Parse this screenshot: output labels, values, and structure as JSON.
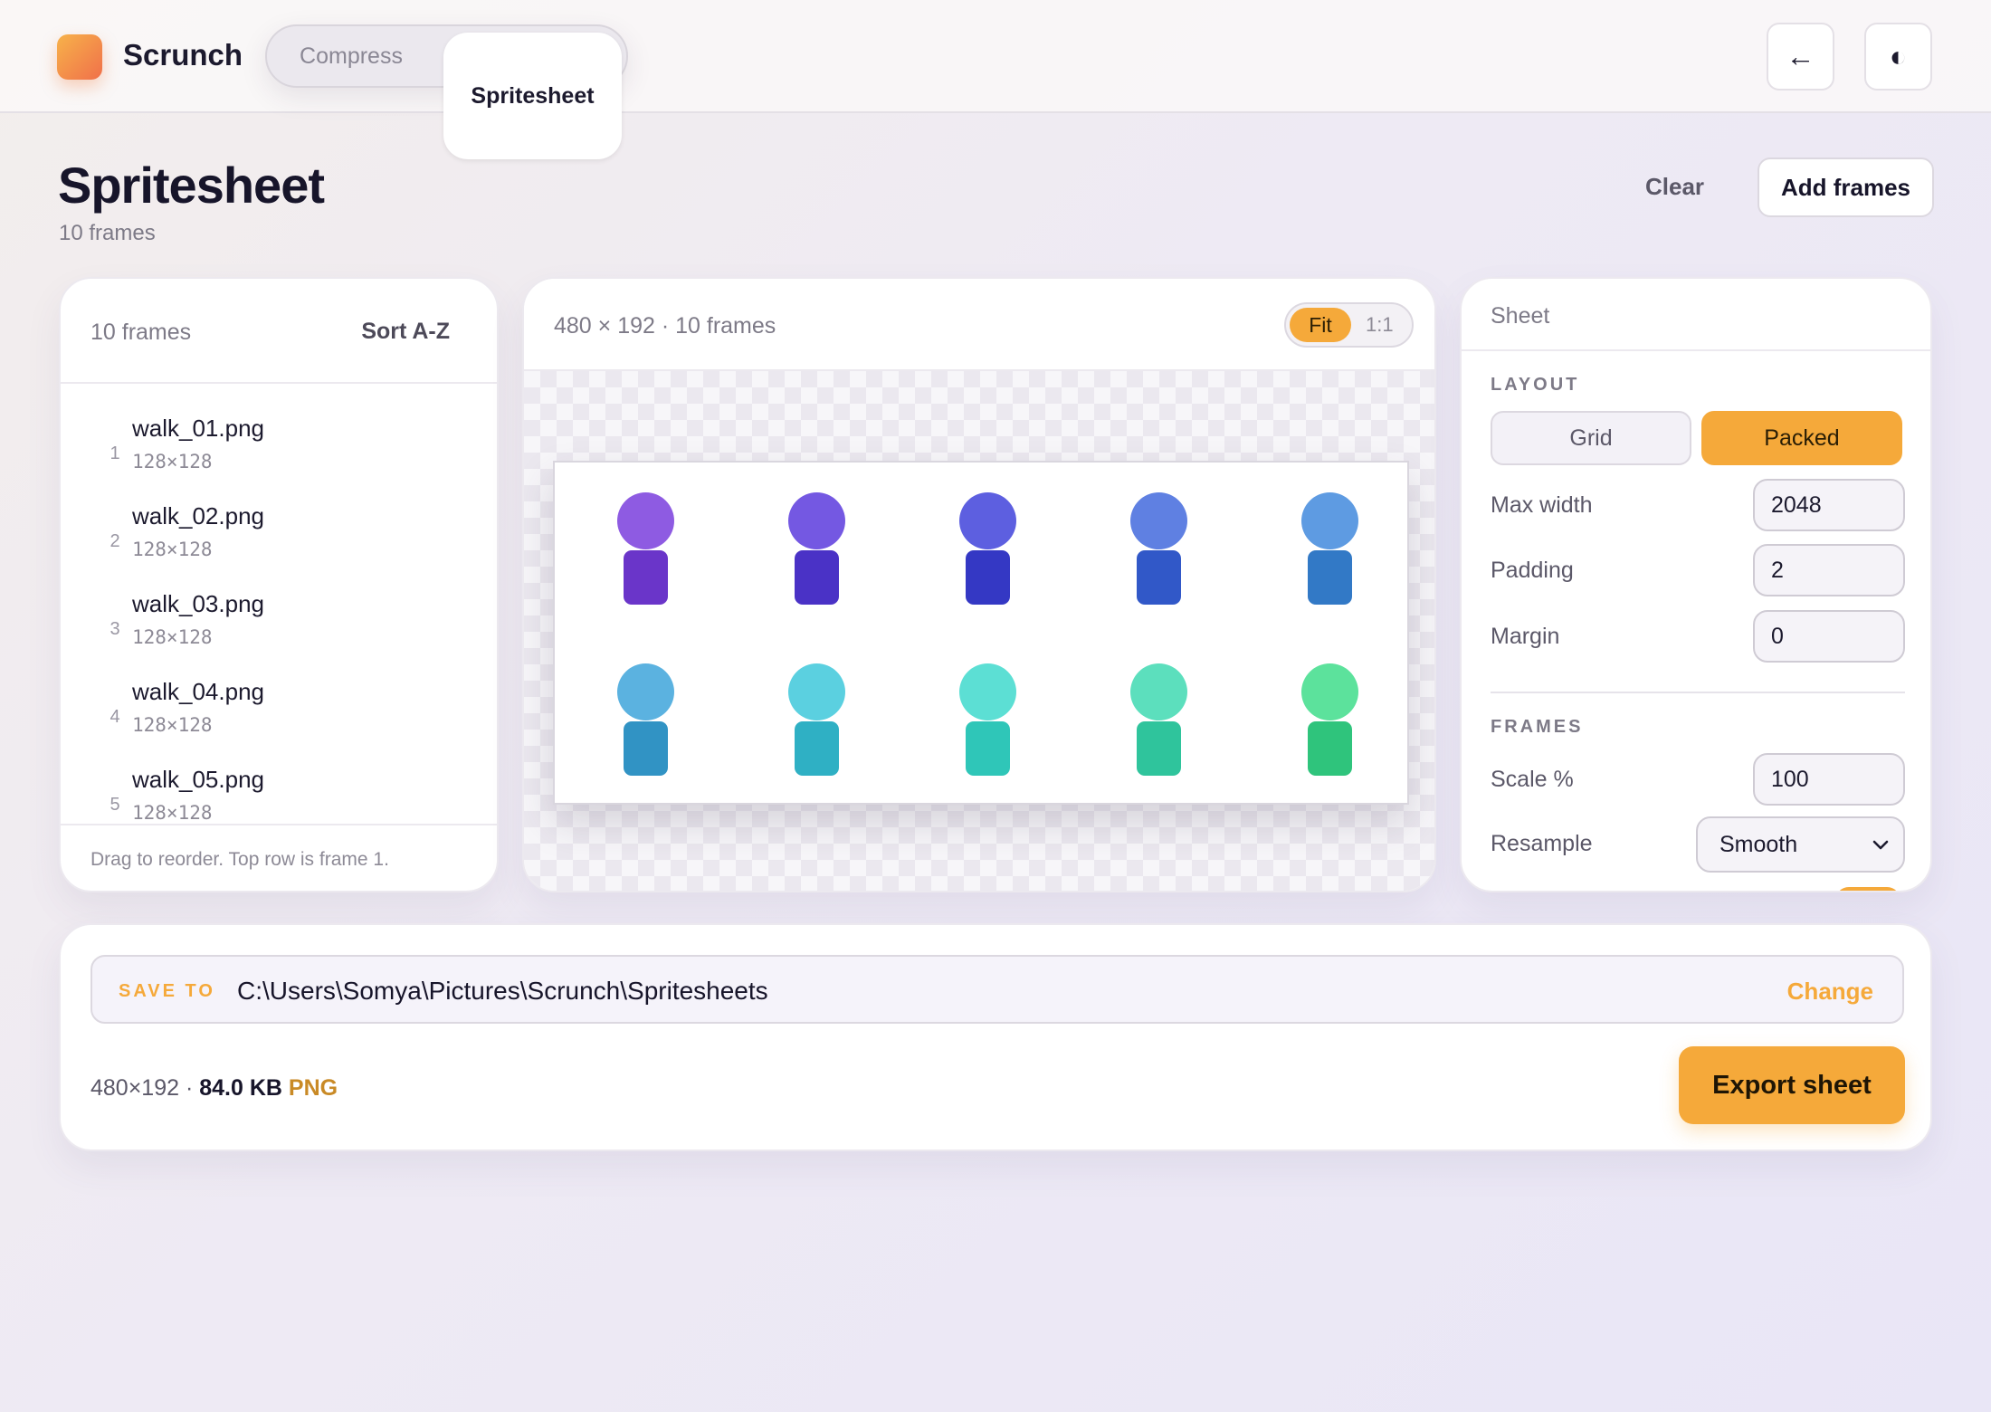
{
  "app": {
    "name": "Scrunch"
  },
  "modes": {
    "compress": "Compress",
    "spritesheet": "Spritesheet"
  },
  "header": {
    "back_icon": "←",
    "theme_icon": "◐"
  },
  "page": {
    "title": "Spritesheet",
    "subtitle": "10 frames",
    "clear": "Clear",
    "add": "Add frames"
  },
  "frames_panel": {
    "count": "10 frames",
    "sort": "Sort A-Z",
    "hint": "Drag to reorder. Top row is frame 1.",
    "items": [
      {
        "index": "1",
        "name": "walk_01.png",
        "size": "128×128"
      },
      {
        "index": "2",
        "name": "walk_02.png",
        "size": "128×128"
      },
      {
        "index": "3",
        "name": "walk_03.png",
        "size": "128×128"
      },
      {
        "index": "4",
        "name": "walk_04.png",
        "size": "128×128"
      },
      {
        "index": "5",
        "name": "walk_05.png",
        "size": "128×128"
      }
    ]
  },
  "preview": {
    "info": "480 × 192 · 10 frames",
    "zoom_fit": "Fit",
    "zoom_actual": "1:1",
    "sprite_colors": [
      {
        "head": "#8e5be2",
        "body": "#6a35c9"
      },
      {
        "head": "#7458e2",
        "body": "#4a32c6"
      },
      {
        "head": "#5d5fe0",
        "body": "#3438c4"
      },
      {
        "head": "#5f80e2",
        "body": "#3158c8"
      },
      {
        "head": "#5e9be2",
        "body": "#3279c6"
      },
      {
        "head": "#5bb2e0",
        "body": "#3193c4"
      },
      {
        "head": "#5bd0e0",
        "body": "#2fb0c4"
      },
      {
        "head": "#5cdfd4",
        "body": "#2fc6b8"
      },
      {
        "head": "#5cdfbd",
        "body": "#2fc49c"
      },
      {
        "head": "#5ce29c",
        "body": "#2fc47c"
      }
    ]
  },
  "sheet": {
    "title": "Sheet",
    "layout_label": "LAYOUT",
    "layout_grid": "Grid",
    "layout_packed": "Packed",
    "max_width_label": "Max width",
    "max_width": "2048",
    "padding_label": "Padding",
    "padding": "2",
    "margin_label": "Margin",
    "margin": "0",
    "frames_label": "FRAMES",
    "scale_label": "Scale %",
    "scale": "100",
    "resample_label": "Resample",
    "resample": "Smooth"
  },
  "export": {
    "save_label": "SAVE TO",
    "path": "C:\\Users\\Somya\\Pictures\\Scrunch\\Spritesheets",
    "change": "Change",
    "dims": "480×192 · ",
    "size": "84.0 KB",
    "format": "PNG",
    "button": "Export sheet"
  },
  "colors": {
    "accent": "#f5a93a",
    "accent_text": "#c98a26"
  }
}
